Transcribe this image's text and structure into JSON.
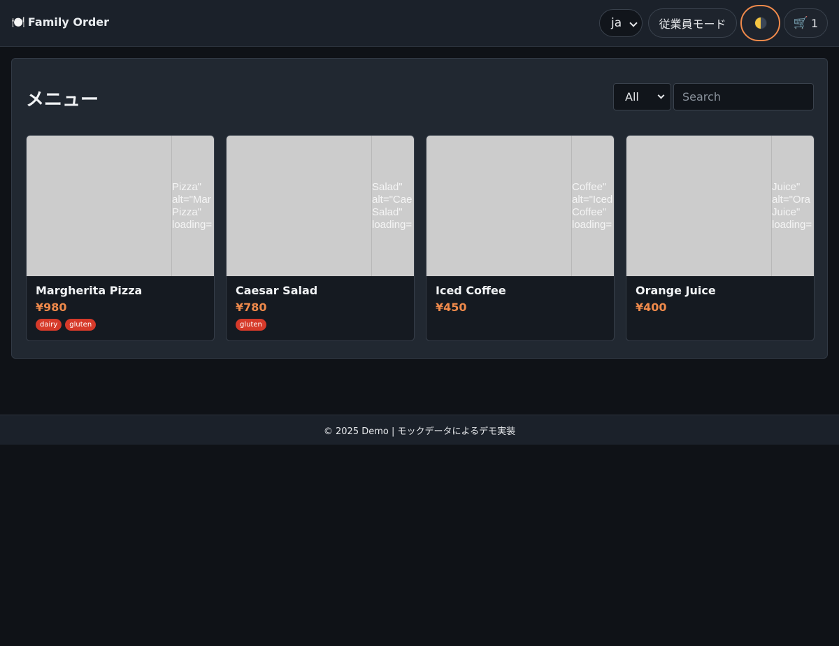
{
  "header": {
    "brand_icon": "🍽️",
    "brand_name": "Family Order",
    "language": "ja",
    "staff_mode_label": "従業員モード",
    "theme_icon": "moon-icon",
    "cart_icon": "🛒",
    "cart_count": "1"
  },
  "main": {
    "title": "メニュー",
    "category_filter": "All",
    "search_placeholder": "Search",
    "items": [
      {
        "name": "Margherita Pizza",
        "price": "¥980",
        "alt_text": "Pizza\"\nalt=\"Mar\nPizza\"\nloading=",
        "tags": [
          "dairy",
          "gluten"
        ]
      },
      {
        "name": "Caesar Salad",
        "price": "¥780",
        "alt_text": "Salad\"\nalt=\"Cae\nSalad\"\nloading=",
        "tags": [
          "gluten"
        ]
      },
      {
        "name": "Iced Coffee",
        "price": "¥450",
        "alt_text": "Coffee\"\nalt=\"Iced\nCoffee\"\nloading=",
        "tags": []
      },
      {
        "name": "Orange Juice",
        "price": "¥400",
        "alt_text": "Juice\"\nalt=\"Ora\nJuice\"\nloading=",
        "tags": []
      }
    ]
  },
  "footer": {
    "text": "© 2025 Demo | モックデータによるデモ実装"
  },
  "colors": {
    "accent": "#f08a4b",
    "tag": "#d63a2a",
    "background": "#0f1217",
    "panel": "#212831"
  }
}
